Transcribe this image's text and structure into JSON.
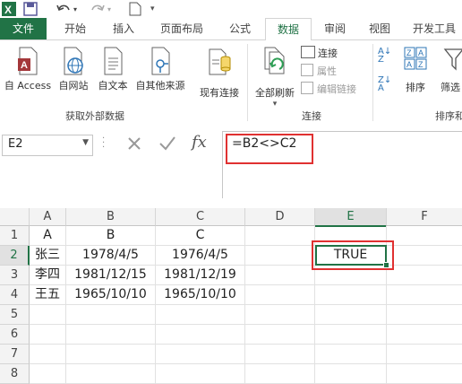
{
  "ribbon": {
    "tabs": [
      "文件",
      "开始",
      "插入",
      "页面布局",
      "公式",
      "数据",
      "审阅",
      "视图",
      "开发工具"
    ],
    "active_tab": "数据",
    "get_external": {
      "access": "自 Access",
      "web": "自网站",
      "text": "自文本",
      "other": "自其他来源",
      "existing": "现有连接",
      "group_label": "获取外部数据"
    },
    "connections": {
      "refresh_all": "全部刷新",
      "connections": "连接",
      "properties": "属性",
      "edit_links": "编辑链接",
      "group_label": "连接"
    },
    "sort": {
      "sort": "排序",
      "filter": "筛选",
      "group_label": "排序和"
    }
  },
  "formula_bar": {
    "name_box": "E2",
    "formula": "=B2<>C2"
  },
  "grid": {
    "columns": [
      "A",
      "B",
      "C",
      "D",
      "E",
      "F"
    ],
    "rows": [
      "1",
      "2",
      "3",
      "4",
      "5",
      "6",
      "7",
      "8"
    ],
    "cells": [
      [
        "A",
        "B",
        "C",
        "",
        "",
        ""
      ],
      [
        "张三",
        "1978/4/5",
        "1976/4/5",
        "",
        "TRUE",
        ""
      ],
      [
        "李四",
        "1981/12/15",
        "1981/12/19",
        "",
        "",
        ""
      ],
      [
        "王五",
        "1965/10/10",
        "1965/10/10",
        "",
        "",
        ""
      ],
      [
        "",
        "",
        "",
        "",
        "",
        ""
      ],
      [
        "",
        "",
        "",
        "",
        "",
        ""
      ],
      [
        "",
        "",
        "",
        "",
        "",
        ""
      ],
      [
        "",
        "",
        "",
        "",
        "",
        ""
      ]
    ],
    "selected_cell": "E2"
  },
  "colors": {
    "excel_green": "#217346",
    "highlight_red": "#e03131"
  }
}
